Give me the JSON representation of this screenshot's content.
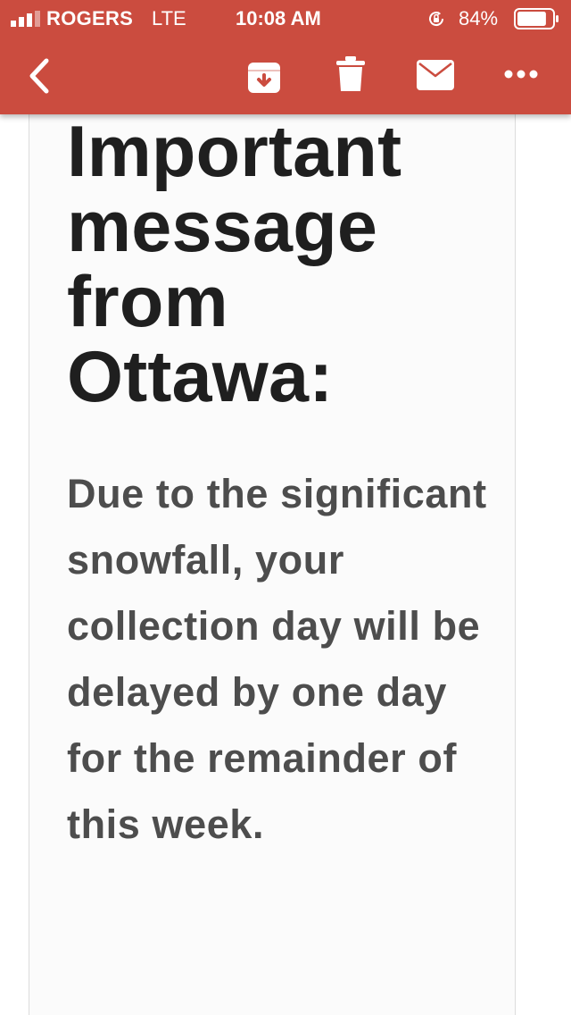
{
  "status_bar": {
    "carrier": "ROGERS",
    "network": "LTE",
    "time": "10:08 AM",
    "battery_percent": "84%",
    "battery_level": 0.84,
    "signal_icon": "signal-bars-icon",
    "rotation_lock_icon": "rotation-lock-icon",
    "battery_icon": "battery-icon"
  },
  "toolbar": {
    "background_color": "#cb4c3f",
    "icons": [
      "back-chevron-icon",
      "archive-icon",
      "trash-icon",
      "mail-icon",
      "more-dots-icon"
    ]
  },
  "message": {
    "headline": "Important message from Ottawa:",
    "body": "Due to the significant snowfall, your collection day will be delayed by one day for the remainder of this week."
  }
}
